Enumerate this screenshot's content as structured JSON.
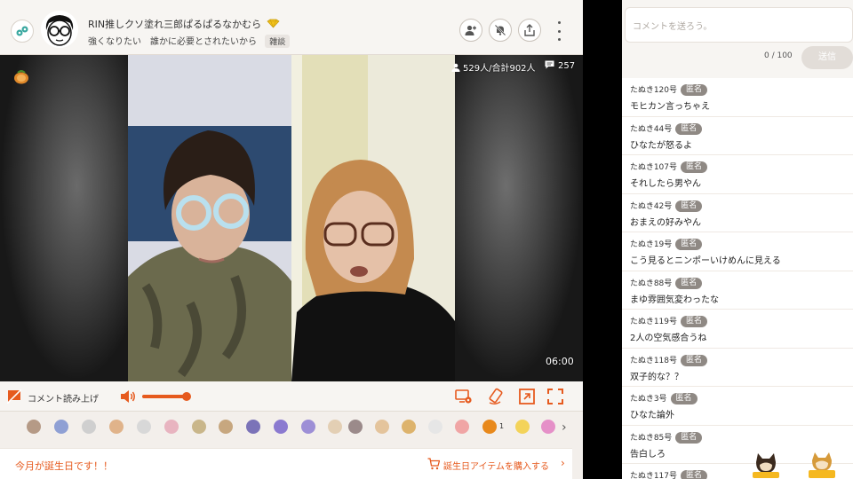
{
  "header": {
    "title": "RIN推しクソ塗れ三郎ぱるぱるなかむら",
    "subtitle": "強くなりたい　誰かに必要とされたいから",
    "tag": "雑談"
  },
  "video": {
    "viewers": "529人/合計902人",
    "comment_count": "257",
    "time": "06:00"
  },
  "controls": {
    "read_comments": "コメント読み上げ"
  },
  "gifts": {
    "count": "1"
  },
  "birthday": {
    "text": "今月が誕生日です！！",
    "link": "誕生日アイテムを購入する",
    "chevron": "›"
  },
  "comment_form": {
    "placeholder": "コメントを送ろう。",
    "char_count": "0 / 100",
    "send": "送信"
  },
  "comments": [
    {
      "name": "たぬき120号",
      "badge": "匿名",
      "text": "モヒカン言っちゃえ"
    },
    {
      "name": "たぬき44号",
      "badge": "匿名",
      "text": "ひなたが怒るよ"
    },
    {
      "name": "たぬき107号",
      "badge": "匿名",
      "text": "それしたら男やん"
    },
    {
      "name": "たぬき42号",
      "badge": "匿名",
      "text": "おまえの好みやん"
    },
    {
      "name": "たぬき19号",
      "badge": "匿名",
      "text": "こう見るとニンポーいけめんに見える"
    },
    {
      "name": "たぬき88号",
      "badge": "匿名",
      "text": "まゆ雰囲気変わったな"
    },
    {
      "name": "たぬき119号",
      "badge": "匿名",
      "text": "2人の空気感合うね"
    },
    {
      "name": "たぬき118号",
      "badge": "匿名",
      "text": "双子的な？？"
    },
    {
      "name": "たぬき3号",
      "badge": "匿名",
      "text": "ひなた論外"
    },
    {
      "name": "たぬき85号",
      "badge": "匿名",
      "text": "告白しろ"
    },
    {
      "name": "たぬき117号",
      "badge": "匿名",
      "text": ""
    }
  ],
  "colors": {
    "accent": "#e65a1e",
    "background": "#f3efeb",
    "badge": "#8f8984"
  }
}
